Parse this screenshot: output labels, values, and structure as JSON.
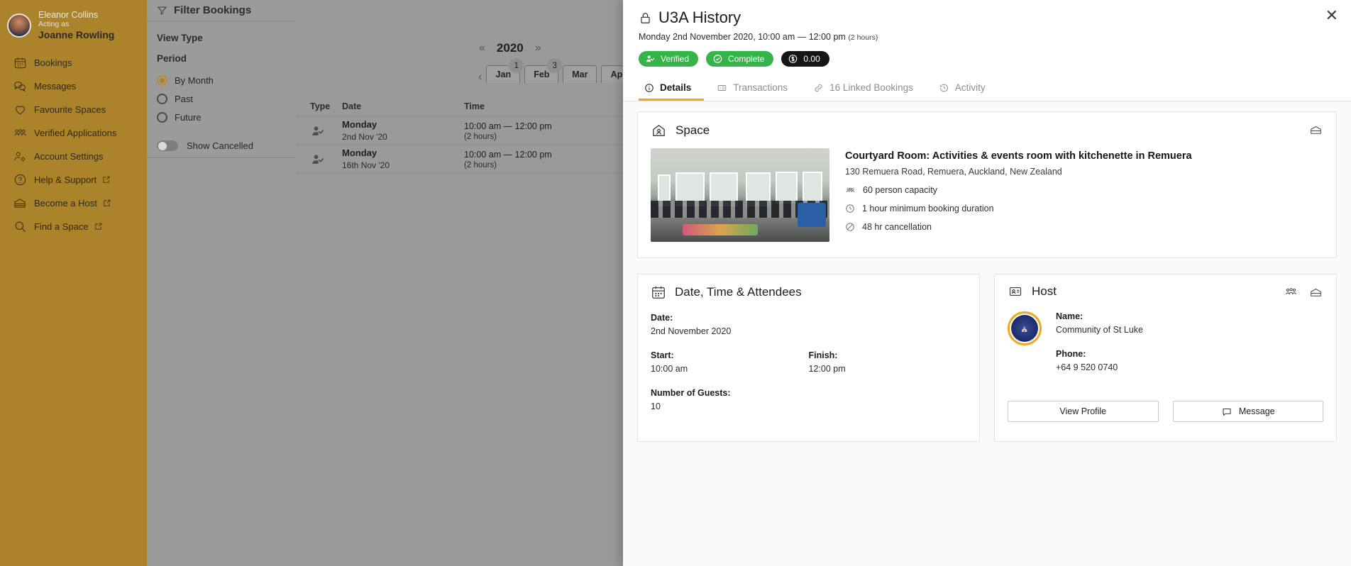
{
  "sidebar": {
    "user": {
      "name": "Eleanor Collins",
      "acting_as_label": "Acting as",
      "acting_as_name": "Joanne Rowling"
    },
    "items": [
      {
        "label": "Bookings",
        "icon": "calendar-icon",
        "external": false
      },
      {
        "label": "Messages",
        "icon": "chat-icon",
        "external": false
      },
      {
        "label": "Favourite Spaces",
        "icon": "heart-icon",
        "external": false
      },
      {
        "label": "Verified Applications",
        "icon": "people-icon",
        "external": false
      },
      {
        "label": "Account Settings",
        "icon": "person-gear-icon",
        "external": false
      },
      {
        "label": "Help & Support",
        "icon": "question-circle-icon",
        "external": true
      },
      {
        "label": "Become a Host",
        "icon": "building-icon",
        "external": true
      },
      {
        "label": "Find a Space",
        "icon": "search-icon",
        "external": true
      }
    ],
    "bg_color": "#ab832a"
  },
  "filters": {
    "title": "Filter Bookings",
    "view_type_label": "View Type",
    "period_label": "Period",
    "period_options": [
      {
        "label": "By Month",
        "selected": true
      },
      {
        "label": "Past",
        "selected": false
      },
      {
        "label": "Future",
        "selected": false
      }
    ],
    "show_cancelled_label": "Show Cancelled",
    "show_cancelled_on": false,
    "accent_color": "#b07f24"
  },
  "bookings": {
    "year": "2020",
    "prev_year_icon": "«",
    "next_year_icon": "»",
    "prev_month_icon": "‹",
    "next_month_icon": "›",
    "months": [
      {
        "label": "Jan",
        "badge": "1"
      },
      {
        "label": "Feb",
        "badge": "3"
      },
      {
        "label": "Mar",
        "badge": ""
      },
      {
        "label": "Apr",
        "badge": ""
      }
    ],
    "columns": [
      "Type",
      "Date",
      "Time"
    ],
    "rows": [
      {
        "type_icon": "person-check-icon",
        "day": "Monday",
        "date": "2nd Nov '20",
        "time": "10:00 am — 12:00 pm",
        "duration": "(2 hours)"
      },
      {
        "type_icon": "person-check-icon",
        "day": "Monday",
        "date": "16th Nov '20",
        "time": "10:00 am — 12:00 pm",
        "duration": "(2 hours)"
      }
    ]
  },
  "modal": {
    "title": "U3A History",
    "title_icon": "lock-icon",
    "subtitle": "Monday 2nd November 2020, 10:00 am — 12:00 pm",
    "subtitle_duration": "(2 hours)",
    "close_icon": "close-icon",
    "badges": [
      {
        "label": "Verified",
        "icon": "person-check-icon",
        "color": "#35b44a"
      },
      {
        "label": "Complete",
        "icon": "check-circle-icon",
        "color": "#35b44a"
      },
      {
        "label": "0.00",
        "icon": "dollar-icon",
        "color": "#151515"
      }
    ],
    "tabs": [
      {
        "label": "Details",
        "icon": "info-icon",
        "active": true
      },
      {
        "label": "Transactions",
        "icon": "receipt-icon",
        "active": false
      },
      {
        "label": "16 Linked Bookings",
        "icon": "link-icon",
        "active": false
      },
      {
        "label": "Activity",
        "icon": "history-icon",
        "active": false
      }
    ],
    "accent_color": "#f0a81e",
    "space": {
      "card_title": "Space",
      "card_icon": "home-person-icon",
      "header_icon": "building-icon",
      "name": "Courtyard Room: Activities & events room with kitchenette in Remuera",
      "address": "130 Remuera Road, Remuera, Auckland, New Zealand",
      "features": [
        {
          "icon": "people-icon",
          "text": "60 person capacity"
        },
        {
          "icon": "clock-icon",
          "text": "1 hour minimum booking duration"
        },
        {
          "icon": "no-entry-icon",
          "text": "48 hr cancellation"
        }
      ]
    },
    "datetime": {
      "card_title": "Date, Time & Attendees",
      "card_icon": "calendar-icon",
      "date_label": "Date:",
      "date_value": "2nd November 2020",
      "start_label": "Start:",
      "start_value": "10:00 am",
      "finish_label": "Finish:",
      "finish_value": "12:00 pm",
      "guests_label": "Number of Guests:",
      "guests_value": "10"
    },
    "host": {
      "card_title": "Host",
      "card_icon": "contact-card-icon",
      "header_icons": [
        "people-group-icon",
        "building-icon"
      ],
      "name_label": "Name:",
      "name_value": "Community of St Luke",
      "phone_label": "Phone:",
      "phone_value": "+64 9 520 0740",
      "view_profile_label": "View Profile",
      "message_label": "Message",
      "message_icon": "chat-icon"
    }
  }
}
